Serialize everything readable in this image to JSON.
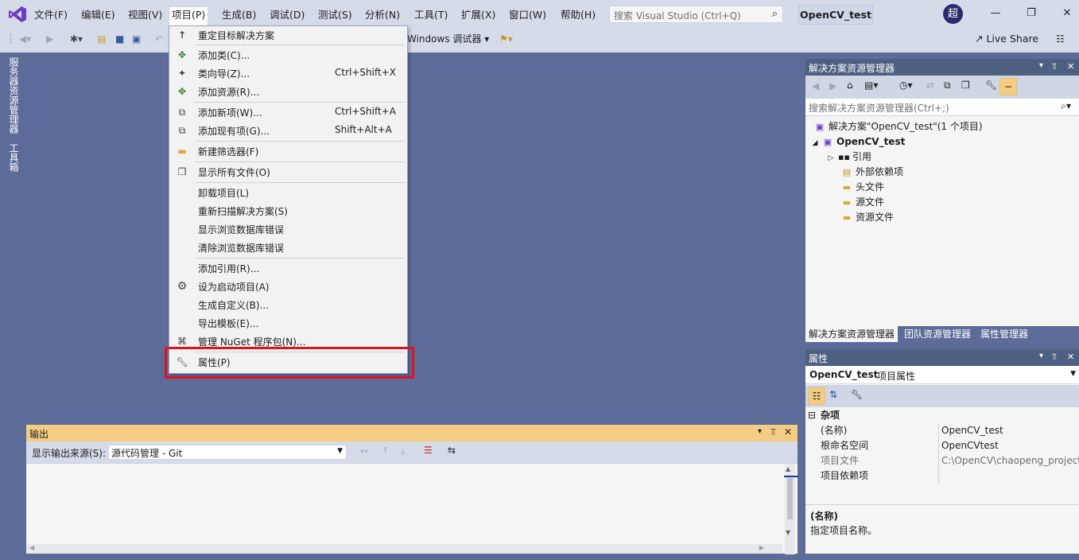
{
  "menubar": {
    "items": [
      "文件(F)",
      "编辑(E)",
      "视图(V)",
      "项目(P)",
      "生成(B)",
      "调试(D)",
      "测试(S)",
      "分析(N)",
      "工具(T)",
      "扩展(X)",
      "窗口(W)",
      "帮助(H)"
    ],
    "active_item": "项目(P)",
    "search_placeholder": "搜索 Visual Studio (Ctrl+Q)",
    "solution_name": "OpenCV_test",
    "avatar_initial": "超"
  },
  "toolbar": {
    "debugger_label": "Windows 调试器",
    "live_share": "Live Share"
  },
  "left_tabs": [
    "服务器资源管理器",
    "工具箱"
  ],
  "project_menu": {
    "items": [
      {
        "icon": "arrow-up-icon",
        "label": "重定目标解决方案",
        "shortcut": ""
      },
      {
        "icon": "add-class-icon",
        "label": "添加类(C)...",
        "shortcut": ""
      },
      {
        "icon": "class-wizard-icon",
        "label": "类向导(Z)...",
        "shortcut": "Ctrl+Shift+X"
      },
      {
        "icon": "add-resource-icon",
        "label": "添加资源(R)...",
        "shortcut": ""
      },
      {
        "icon": "add-new-item-icon",
        "label": "添加新项(W)...",
        "shortcut": "Ctrl+Shift+A"
      },
      {
        "icon": "add-existing-item-icon",
        "label": "添加现有项(G)...",
        "shortcut": "Shift+Alt+A"
      },
      {
        "icon": "new-filter-icon",
        "label": "新建筛选器(F)",
        "shortcut": ""
      },
      {
        "icon": "show-all-files-icon",
        "label": "显示所有文件(O)",
        "shortcut": ""
      },
      {
        "icon": "",
        "label": "卸载项目(L)",
        "shortcut": ""
      },
      {
        "icon": "",
        "label": "重新扫描解决方案(S)",
        "shortcut": ""
      },
      {
        "icon": "",
        "label": "显示浏览数据库错误",
        "shortcut": ""
      },
      {
        "icon": "",
        "label": "清除浏览数据库错误",
        "shortcut": ""
      },
      {
        "icon": "",
        "label": "添加引用(R)...",
        "shortcut": ""
      },
      {
        "icon": "gear-icon",
        "label": "设为启动项目(A)",
        "shortcut": ""
      },
      {
        "icon": "",
        "label": "生成自定义(B)...",
        "shortcut": ""
      },
      {
        "icon": "",
        "label": "导出模板(E)...",
        "shortcut": ""
      },
      {
        "icon": "nuget-icon",
        "label": "管理 NuGet 程序包(N)...",
        "shortcut": ""
      },
      {
        "icon": "wrench-icon",
        "label": "属性(P)",
        "shortcut": ""
      }
    ]
  },
  "output": {
    "title": "输出",
    "source_label": "显示输出来源(S):",
    "source_value": "源代码管理 - Git"
  },
  "solution_explorer": {
    "title": "解决方案资源管理器",
    "search_placeholder": "搜索解决方案资源管理器(Ctrl+;)",
    "solution_node": "解决方案\"OpenCV_test\"(1 个项目)",
    "project_node": "OpenCV_test",
    "children": [
      "引用",
      "外部依赖项",
      "头文件",
      "源文件",
      "资源文件"
    ],
    "tabs": [
      "解决方案资源管理器",
      "团队资源管理器",
      "属性管理器"
    ]
  },
  "properties": {
    "title": "属性",
    "object_name": "OpenCV_test",
    "object_type": "项目属性",
    "category": "杂项",
    "rows": [
      {
        "key": "(名称)",
        "value": "OpenCV_test"
      },
      {
        "key": "根命名空间",
        "value": "OpenCVtest"
      },
      {
        "key": "项目文件",
        "value": "C:\\OpenCV\\chaopeng_project"
      },
      {
        "key": "项目依赖项",
        "value": ""
      }
    ],
    "desc_title": "(名称)",
    "desc_text": "指定项目名称。"
  }
}
